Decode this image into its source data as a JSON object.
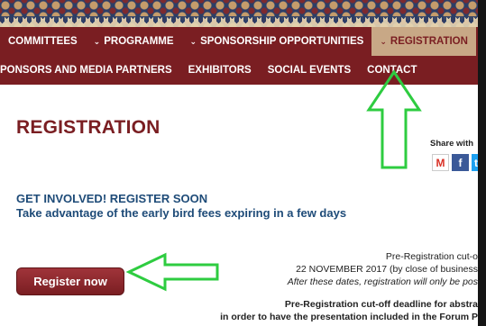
{
  "nav": {
    "row1": [
      {
        "label": "COMMITTEES",
        "dropdown": false,
        "active": false
      },
      {
        "label": "PROGRAMME",
        "dropdown": true,
        "active": false
      },
      {
        "label": "SPONSORSHIP OPPORTUNITIES",
        "dropdown": true,
        "active": false
      },
      {
        "label": "REGISTRATION",
        "dropdown": true,
        "active": true
      }
    ],
    "row2": [
      {
        "label": "PONSORS AND MEDIA PARTNERS"
      },
      {
        "label": "EXHIBITORS"
      },
      {
        "label": "SOCIAL EVENTS"
      },
      {
        "label": "CONTACT"
      }
    ],
    "chevron_glyph": "⌄"
  },
  "page": {
    "title": "REGISTRATION",
    "share_label": "Share with",
    "share_icons": [
      {
        "name": "gmail-icon",
        "glyph": "M"
      },
      {
        "name": "facebook-icon",
        "glyph": "f"
      },
      {
        "name": "twitter-icon",
        "glyph": "t"
      }
    ],
    "involved_heading": "GET INVOLVED! REGISTER SOON",
    "involved_sub": "Take advantage of the early bird fees expiring in a few days",
    "register_button": "Register now",
    "pre_registration": {
      "cutoff": "Pre-Registration cut-o",
      "date": "22 NOVEMBER 2017 (by close of business",
      "after": "After these dates, registration will only be pos",
      "abstract_deadline": "Pre-Registration cut-off deadline for abstra",
      "order_note": "in order to have the presentation included in the Forum P"
    }
  },
  "colors": {
    "brand": "#7a1e22",
    "active_tab": "#c8a886",
    "heading_blue": "#1e4b78",
    "annotation_arrow": "#2ecc40"
  }
}
